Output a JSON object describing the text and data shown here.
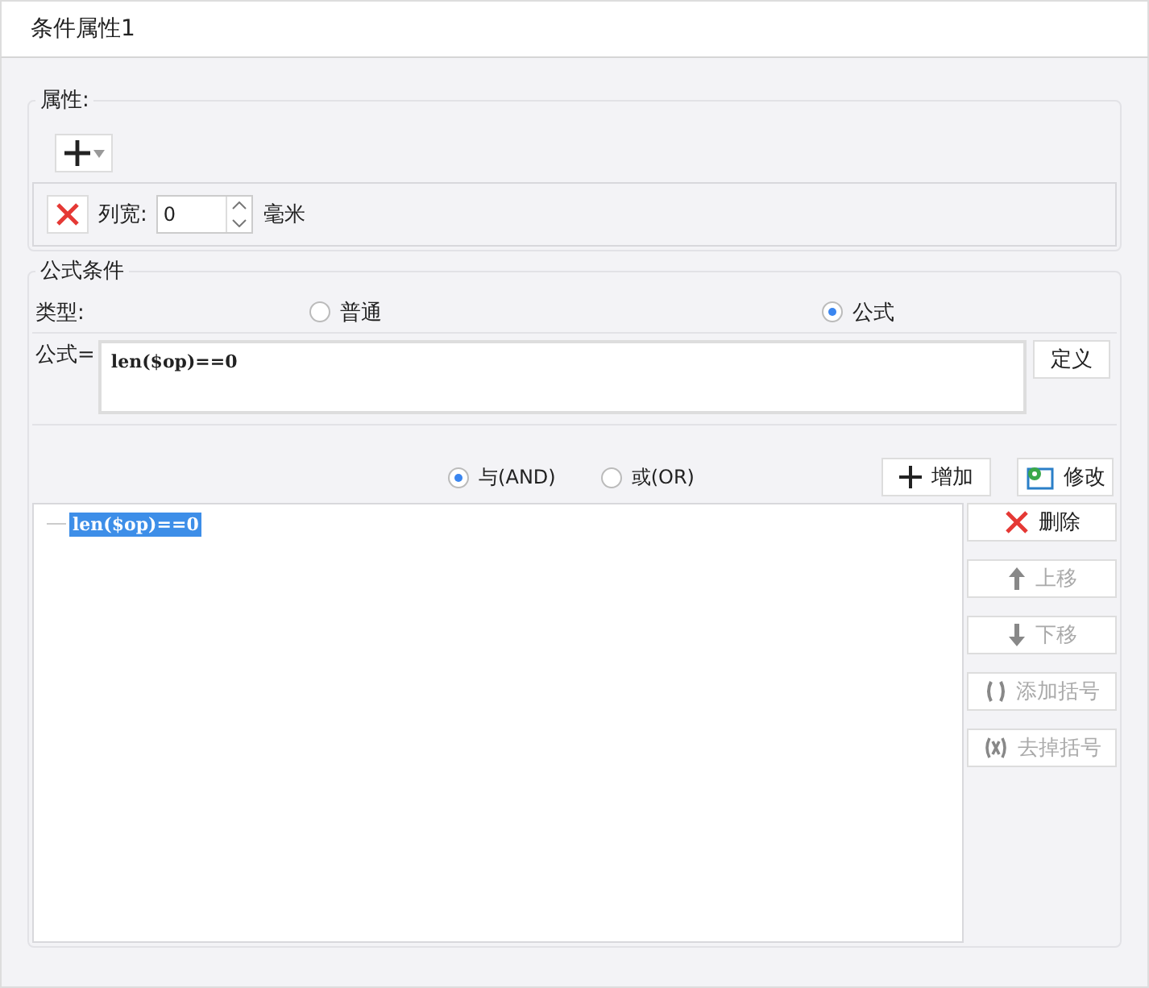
{
  "window": {
    "title": "条件属性1"
  },
  "attributes": {
    "legend": "属性:",
    "width_label": "列宽:",
    "width_value": "0",
    "width_unit": "毫米"
  },
  "formula_condition": {
    "legend": "公式条件",
    "type_label": "类型:",
    "types": [
      {
        "label": "普通",
        "selected": false
      },
      {
        "label": "公式",
        "selected": true
      }
    ],
    "formula_label": "公式=",
    "formula_value": "len($op)==0",
    "define_button": "定义",
    "logic": [
      {
        "label": "与(AND)",
        "selected": true
      },
      {
        "label": "或(OR)",
        "selected": false
      }
    ],
    "add_button": "增加",
    "modify_button": "修改",
    "conditions": [
      {
        "text": "len($op)==0",
        "selected": true
      }
    ],
    "actions": [
      {
        "kind": "delete",
        "label": "删除",
        "disabled": false
      },
      {
        "kind": "up",
        "label": "上移",
        "disabled": true
      },
      {
        "kind": "down",
        "label": "下移",
        "disabled": true
      },
      {
        "kind": "add-paren",
        "label": "添加括号",
        "disabled": true
      },
      {
        "kind": "remove-paren",
        "label": "去掉括号",
        "disabled": true
      }
    ]
  }
}
